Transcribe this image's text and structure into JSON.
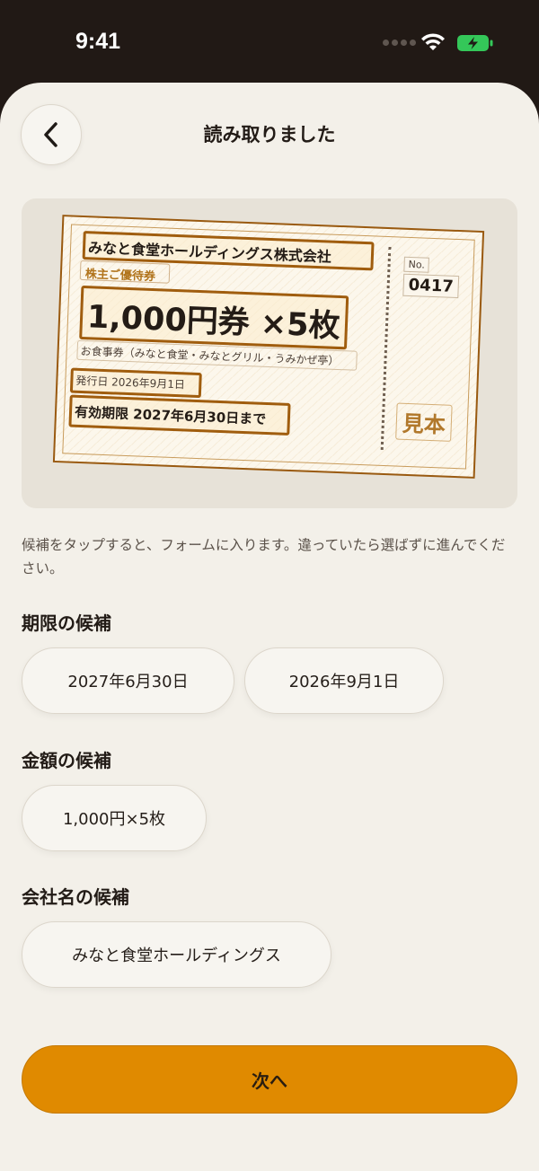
{
  "status_bar": {
    "time": "9:41"
  },
  "header": {
    "title": "読み取りました"
  },
  "ticket": {
    "company": "みなと食堂ホールディングス株式会社",
    "badge": "株主ご優待券",
    "amount": "1,000円券 ×5枚",
    "venues": "お食事券（みなと食堂・みなとグリル・うみかぜ亭）",
    "issue_date": "発行日 2026年9月1日",
    "expiry": "有効期限 2027年6月30日まで",
    "no_label": "No.",
    "no_value": "0417",
    "sample_stamp": "見本"
  },
  "helper_text": "候補をタップすると、フォームに入ります。違っていたら選ばずに進んでください。",
  "sections": {
    "deadline": {
      "heading": "期限の候補",
      "chips": [
        "2027年6月30日",
        "2026年9月1日"
      ]
    },
    "amount": {
      "heading": "金額の候補",
      "chips": [
        "1,000円×5枚"
      ]
    },
    "company": {
      "heading": "会社名の候補",
      "chips": [
        "みなと食堂ホールディングス"
      ]
    }
  },
  "next_button": {
    "label": "次へ"
  },
  "colors": {
    "accent": "#e08a00",
    "background": "#f3f0e9",
    "highlight_box": "#a05d0e",
    "battery": "#34c759"
  },
  "icons": {
    "back": "chevron-left-icon",
    "wifi": "wifi-icon",
    "battery": "battery-charging-icon"
  }
}
